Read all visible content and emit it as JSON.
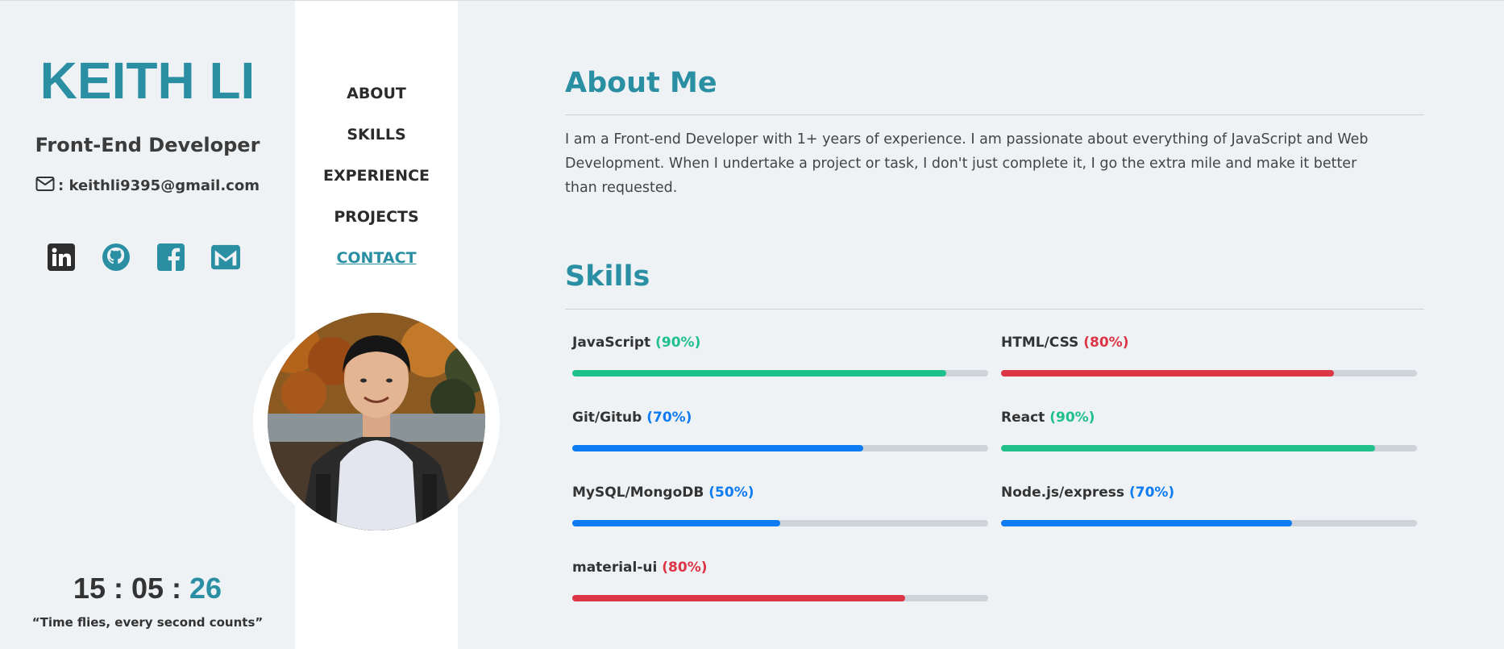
{
  "profile": {
    "name": "KEITH LI",
    "role": "Front-End Developer",
    "email_label": ": keithli9395@gmail.com"
  },
  "socials": [
    {
      "name": "linkedin-icon"
    },
    {
      "name": "github-icon"
    },
    {
      "name": "facebook-icon"
    },
    {
      "name": "gmail-icon"
    }
  ],
  "clock": {
    "hours": "15",
    "sep1": " : ",
    "minutes": "05",
    "sep2": " : ",
    "seconds": "26",
    "quote": "“Time flies, every second counts”"
  },
  "nav": {
    "items": [
      {
        "label": "ABOUT",
        "active": false
      },
      {
        "label": "SKILLS",
        "active": false
      },
      {
        "label": "EXPERIENCE",
        "active": false
      },
      {
        "label": "PROJECTS",
        "active": false
      },
      {
        "label": "CONTACT",
        "active": true
      }
    ]
  },
  "about": {
    "heading": "About Me",
    "text": "I am a Front-end Developer with 1+ years of experience. I am passionate about everything of JavaScript and Web Development. When I undertake a project or task, I don't just complete it, I go the extra mile and make it better than requested."
  },
  "skills": {
    "heading": "Skills",
    "items": [
      {
        "name": "JavaScript",
        "pct_label": "(90%)",
        "value": 0.9,
        "color": "#20c08a"
      },
      {
        "name": "HTML/CSS",
        "pct_label": "(80%)",
        "value": 0.8,
        "color": "#dc3545"
      },
      {
        "name": "Git/Gitub",
        "pct_label": "(70%)",
        "value": 0.7,
        "color": "#0d7bf2"
      },
      {
        "name": "React",
        "pct_label": "(90%)",
        "value": 0.9,
        "color": "#20c08a"
      },
      {
        "name": "MySQL/MongoDB",
        "pct_label": "(50%)",
        "value": 0.5,
        "color": "#0d7bf2"
      },
      {
        "name": "Node.js/express",
        "pct_label": "(70%)",
        "value": 0.7,
        "color": "#0d7bf2"
      },
      {
        "name": "material-ui",
        "pct_label": "(80%)",
        "value": 0.8,
        "color": "#dc3545"
      }
    ]
  },
  "colors": {
    "accent": "#2a8fa3",
    "background": "#eff2f5",
    "nav_background": "#ffffff"
  }
}
